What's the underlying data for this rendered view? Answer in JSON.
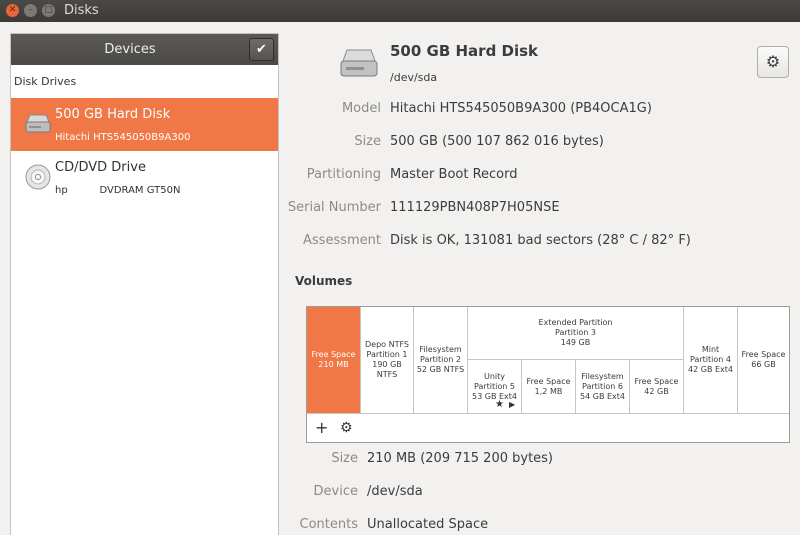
{
  "window": {
    "title": "Disks"
  },
  "sidebar": {
    "header": "Devices",
    "section_label": "Disk Drives",
    "items": [
      {
        "name": "500 GB Hard Disk",
        "sub": "Hitachi HTS545050B9A300",
        "icon": "hard-disk-icon",
        "selected": true
      },
      {
        "name": "CD/DVD Drive",
        "sub": "hp          DVDRAM GT50N",
        "icon": "optical-disc-icon",
        "selected": false
      }
    ]
  },
  "disk": {
    "title": "500 GB Hard Disk",
    "device": "/dev/sda",
    "fields": [
      {
        "label": "Model",
        "value": "Hitachi HTS545050B9A300 (PB4OCA1G)"
      },
      {
        "label": "Size",
        "value": "500 GB (500 107 862 016 bytes)"
      },
      {
        "label": "Partitioning",
        "value": "Master Boot Record"
      },
      {
        "label": "Serial Number",
        "value": "111129PBN408P7H05NSE"
      },
      {
        "label": "Assessment",
        "value": "Disk is OK, 131081 bad sectors (28° C / 82° F)"
      }
    ]
  },
  "volumes": {
    "heading": "Volumes",
    "top": [
      {
        "lines": [
          "Free Space",
          "210 MB"
        ],
        "selected": true
      },
      {
        "lines": [
          "Depo NTFS",
          "Partition 1",
          "190 GB NTFS"
        ]
      },
      {
        "lines": [
          "Filesystem",
          "Partition 2",
          "52 GB NTFS"
        ]
      },
      {
        "lines": [
          "Extended Partition",
          "Partition 3",
          "149 GB"
        ]
      },
      {
        "lines": [
          "Mint",
          "Partition 4",
          "42 GB Ext4"
        ]
      },
      {
        "lines": [
          "Free Space",
          "66 GB"
        ]
      }
    ],
    "logical": [
      {
        "lines": [
          "Unity",
          "Partition 5",
          "53 GB Ext4"
        ]
      },
      {
        "lines": [
          "Free Space",
          "1,2 MB"
        ]
      },
      {
        "lines": [
          "Filesystem",
          "Partition 6",
          "54 GB Ext4"
        ]
      },
      {
        "lines": [
          "Free Space",
          "42 GB"
        ]
      }
    ],
    "toolbar": {
      "add": "+",
      "configure": "⚙"
    }
  },
  "selected_volume": {
    "fields": [
      {
        "label": "Size",
        "value": "210 MB (209 715 200 bytes)"
      },
      {
        "label": "Device",
        "value": "/dev/sda"
      },
      {
        "label": "Contents",
        "value": "Unallocated Space"
      }
    ]
  },
  "colors": {
    "accent": "#f07746",
    "titlebar": "#3c3b37"
  }
}
